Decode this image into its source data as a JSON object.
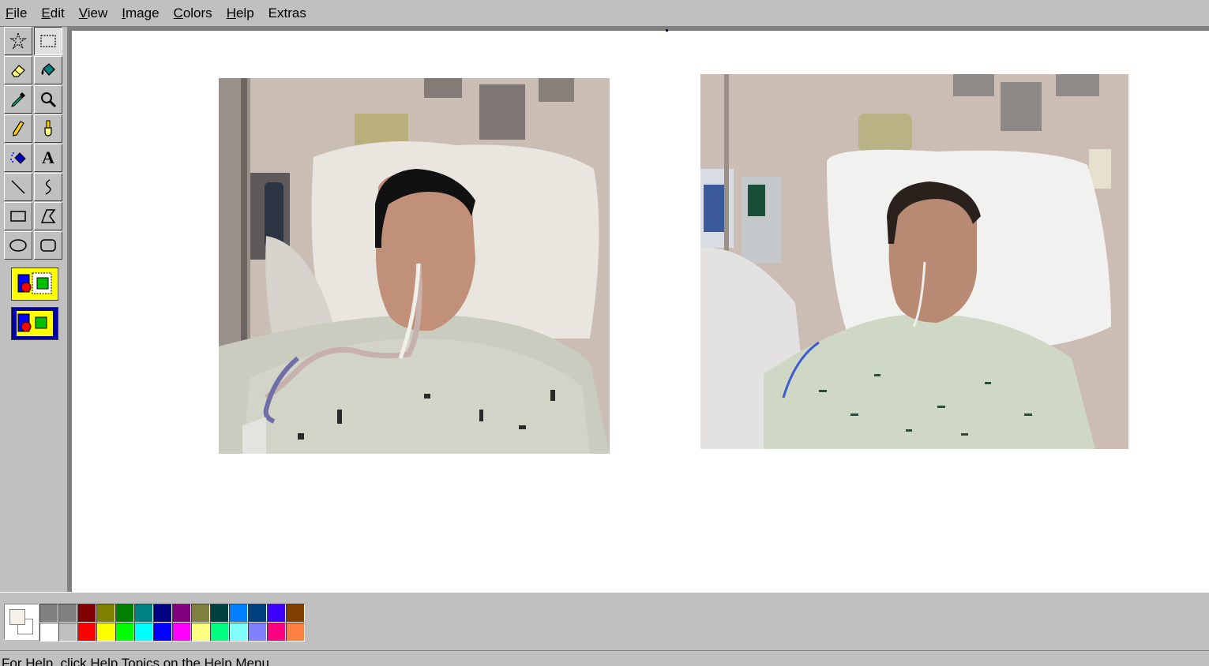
{
  "menu": {
    "items": [
      {
        "label": "File",
        "accel": "F",
        "rest": "ile"
      },
      {
        "label": "Edit",
        "accel": "E",
        "rest": "dit"
      },
      {
        "label": "View",
        "accel": "V",
        "rest": "iew"
      },
      {
        "label": "Image",
        "accel": "I",
        "rest": "mage"
      },
      {
        "label": "Colors",
        "accel": "C",
        "rest": "olors"
      },
      {
        "label": "Help",
        "accel": "H",
        "rest": "elp"
      },
      {
        "label": "Extras",
        "accel": "",
        "rest": "Extras"
      }
    ]
  },
  "toolbox": {
    "tools": [
      {
        "name": "free-form-select",
        "icon": "star-select-icon"
      },
      {
        "name": "rect-select",
        "icon": "dashed-rect-icon",
        "active": true
      },
      {
        "name": "eraser",
        "icon": "eraser-icon"
      },
      {
        "name": "fill",
        "icon": "paint-bucket-icon"
      },
      {
        "name": "pick-color",
        "icon": "eyedropper-icon"
      },
      {
        "name": "magnifier",
        "icon": "magnifier-icon"
      },
      {
        "name": "pencil",
        "icon": "pencil-icon"
      },
      {
        "name": "brush",
        "icon": "brush-icon"
      },
      {
        "name": "airbrush",
        "icon": "airbrush-icon"
      },
      {
        "name": "text",
        "icon": "text-icon",
        "glyph": "A"
      },
      {
        "name": "line",
        "icon": "line-icon"
      },
      {
        "name": "curve",
        "icon": "curve-icon"
      },
      {
        "name": "rectangle",
        "icon": "rectangle-icon"
      },
      {
        "name": "polygon",
        "icon": "polygon-icon"
      },
      {
        "name": "ellipse",
        "icon": "ellipse-icon"
      },
      {
        "name": "rounded-rectangle",
        "icon": "rounded-rect-icon"
      }
    ],
    "options": [
      "opaque-selection-option",
      "transparent-selection-option"
    ]
  },
  "canvas": {
    "images": [
      "painting-image",
      "photo-image"
    ]
  },
  "colors": {
    "foreground": "#f4f1e8",
    "background": "#ffffff",
    "palette_top": [
      "#808080",
      "#808080",
      "#800000",
      "#808000",
      "#008000",
      "#008080",
      "#000080",
      "#800080",
      "#808040",
      "#004040",
      "#0080ff",
      "#004080",
      "#4000ff",
      "#804000"
    ],
    "palette_bottom": [
      "#ffffff",
      "#c0c0c0",
      "#ff0000",
      "#ffff00",
      "#00ff00",
      "#00ffff",
      "#0000ff",
      "#ff00ff",
      "#ffff80",
      "#00ff80",
      "#80ffff",
      "#8080ff",
      "#ff0080",
      "#ff8040"
    ]
  },
  "status": {
    "text": "For Help, click Help Topics on the Help Menu."
  }
}
